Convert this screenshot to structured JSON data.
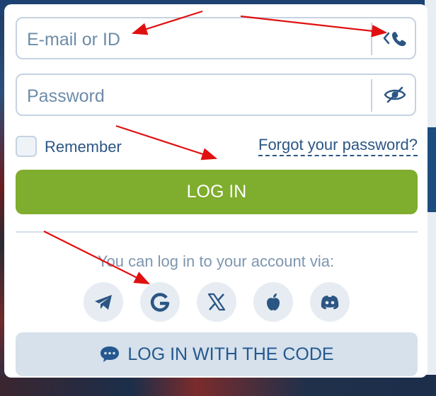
{
  "form": {
    "email_placeholder": "E-mail or ID",
    "password_placeholder": "Password",
    "remember_label": "Remember",
    "forgot_link": "Forgot your password?",
    "login_button": "LOG IN",
    "via_text": "You can log in to your account via:",
    "code_button": "LOG IN WITH THE CODE"
  },
  "social_icons": [
    "telegram-icon",
    "google-icon",
    "x-icon",
    "apple-icon",
    "discord-icon"
  ],
  "colors": {
    "accent_green": "#7fad2e",
    "text_blue": "#2b5684",
    "border": "#c5d3e2",
    "annotation_red": "#e01010"
  }
}
